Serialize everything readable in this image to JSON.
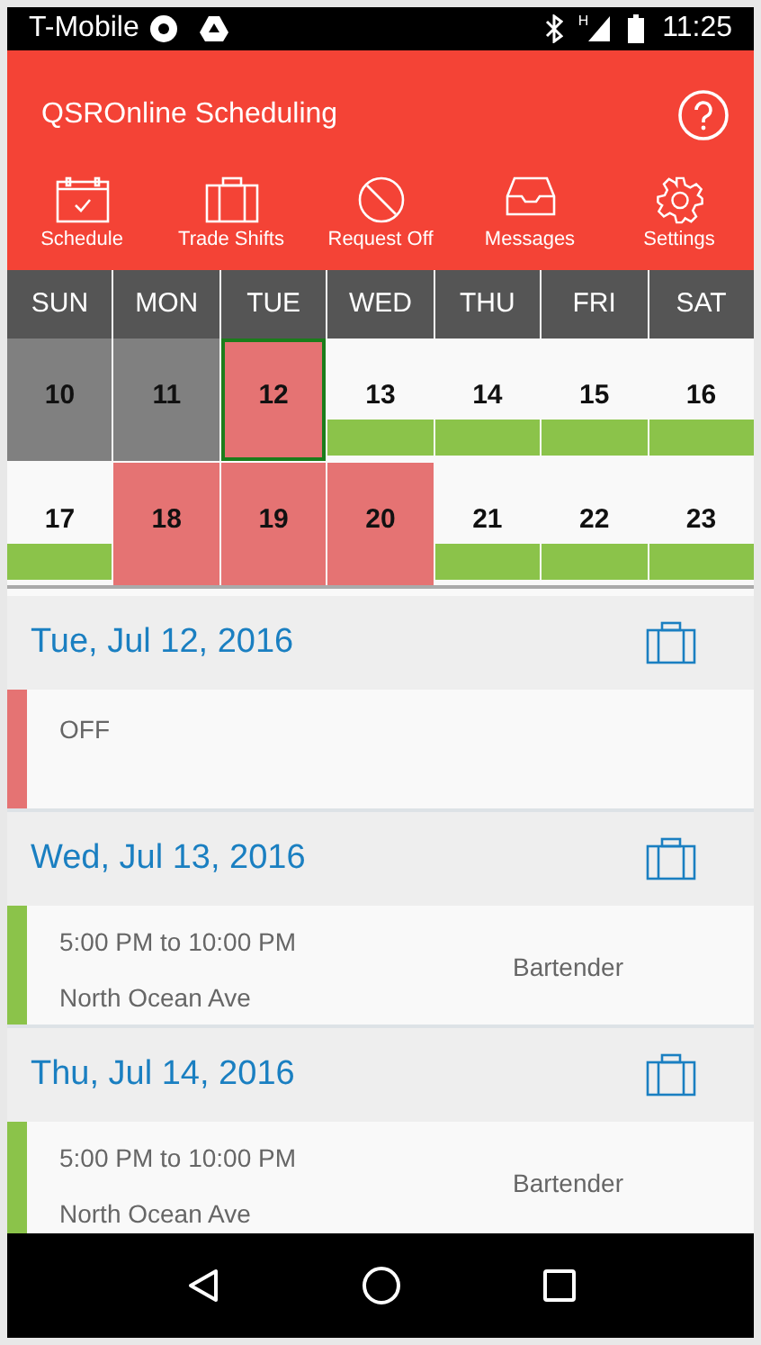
{
  "status_bar": {
    "carrier": "T-Mobile",
    "network": "H",
    "time": "11:25"
  },
  "app_bar": {
    "title": "QSROnline Scheduling"
  },
  "nav": [
    {
      "kind": "schedule",
      "label": "Schedule"
    },
    {
      "kind": "trade",
      "label": "Trade Shifts"
    },
    {
      "kind": "request",
      "label": "Request Off"
    },
    {
      "kind": "messages",
      "label": "Messages"
    },
    {
      "kind": "settings",
      "label": "Settings"
    }
  ],
  "calendar": {
    "weekdays": [
      "SUN",
      "MON",
      "TUE",
      "WED",
      "THU",
      "FRI",
      "SAT"
    ],
    "weeks": [
      [
        {
          "day": "10",
          "kind": "past",
          "shift": false,
          "selected": false
        },
        {
          "day": "11",
          "kind": "past",
          "shift": false,
          "selected": false
        },
        {
          "day": "12",
          "kind": "off",
          "shift": false,
          "selected": true
        },
        {
          "day": "13",
          "kind": "normal",
          "shift": true,
          "selected": false
        },
        {
          "day": "14",
          "kind": "normal",
          "shift": true,
          "selected": false
        },
        {
          "day": "15",
          "kind": "normal",
          "shift": true,
          "selected": false
        },
        {
          "day": "16",
          "kind": "normal",
          "shift": true,
          "selected": false
        }
      ],
      [
        {
          "day": "17",
          "kind": "normal",
          "shift": true,
          "selected": false
        },
        {
          "day": "18",
          "kind": "off",
          "shift": false,
          "selected": false
        },
        {
          "day": "19",
          "kind": "off",
          "shift": false,
          "selected": false
        },
        {
          "day": "20",
          "kind": "off",
          "shift": false,
          "selected": false
        },
        {
          "day": "21",
          "kind": "normal",
          "shift": true,
          "selected": false
        },
        {
          "day": "22",
          "kind": "normal",
          "shift": true,
          "selected": false
        },
        {
          "day": "23",
          "kind": "normal",
          "shift": true,
          "selected": false
        }
      ]
    ]
  },
  "days": [
    {
      "date": "Tue, Jul 12, 2016",
      "entry": {
        "kind": "off",
        "color": "#e57373",
        "label": "OFF"
      }
    },
    {
      "date": "Wed, Jul 13, 2016",
      "entry": {
        "kind": "shift",
        "color": "#8bc34a",
        "time": "5:00 PM to 10:00 PM",
        "location": "North Ocean Ave",
        "role": "Bartender"
      }
    },
    {
      "date": "Thu, Jul 14, 2016",
      "entry": {
        "kind": "shift",
        "color": "#8bc34a",
        "time": "5:00 PM to 10:00 PM",
        "location": "North Ocean Ave",
        "role": "Bartender"
      }
    }
  ]
}
